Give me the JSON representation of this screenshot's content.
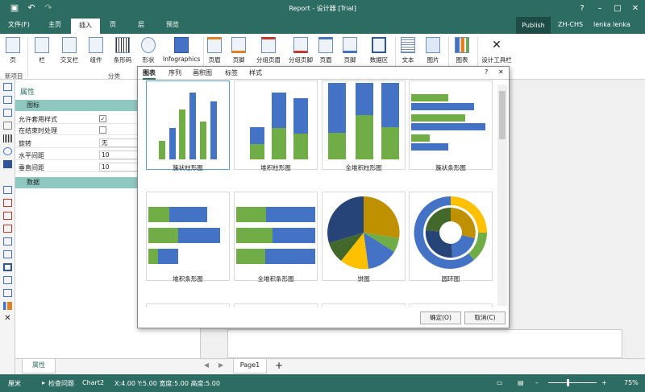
{
  "title_bar": {
    "title": "Report - 设计器 [Trial]",
    "save_icon": "save-icon",
    "undo_icon": "undo-icon",
    "redo_icon": "redo-icon",
    "window_controls": [
      "help-icon",
      "minimize-icon",
      "maximize-icon",
      "close-icon"
    ]
  },
  "menu": {
    "tabs": [
      "文件(F)",
      "主页",
      "插入",
      "页",
      "层",
      "预览"
    ],
    "active": "插入",
    "publish": "Publish",
    "language": "ZH-CHS",
    "user": "lenka lenka"
  },
  "ribbon": {
    "buttons": [
      "页",
      "栏",
      "交叉栏",
      "组件",
      "条形码",
      "形状",
      "Infographics",
      "页眉",
      "页脚",
      "分组页眉",
      "分组页脚",
      "页眉",
      "页脚",
      "数据区",
      "文本",
      "图片",
      "图表",
      "设计工具栏"
    ],
    "groups": [
      "新项目",
      "分类"
    ]
  },
  "properties": {
    "header": "属性",
    "section1": "图标",
    "rows": [
      {
        "key": "允许套用样式",
        "type": "check",
        "value": "✓"
      },
      {
        "key": "在结束时处理",
        "type": "check",
        "value": ""
      },
      {
        "key": "旋转",
        "type": "text",
        "value": "无"
      },
      {
        "key": "水平间距",
        "type": "text",
        "value": "10"
      },
      {
        "key": "垂直间距",
        "type": "text",
        "value": "10"
      }
    ],
    "section2": "数据"
  },
  "dialog": {
    "tabs": [
      "图表",
      "序列",
      "画积图",
      "标签",
      "样式"
    ],
    "active_tab": "图表",
    "help": "?",
    "tiles": [
      "簇状柱形图",
      "堆积柱形图",
      "全堆积柱形图",
      "簇状条形图",
      "堆积条形图",
      "全堆积条形图",
      "饼图",
      "圆环图"
    ],
    "ok": "确定(O)",
    "cancel": "取消(C)"
  },
  "bottom": {
    "tab": "属性",
    "page_tab": "Page1",
    "add": "+"
  },
  "status": {
    "unit": "厘米",
    "check": "检查问题",
    "component": "Chart2",
    "geometry": "X:4.00 Y:5.00 宽度:5.00 高度:5.00",
    "zoom": "75%"
  },
  "colors": {
    "teal": "#2d6c62",
    "blue": "#4472c4",
    "green": "#70ad47",
    "gold": "#bf9000",
    "yellow": "#ffc000",
    "navy": "#264478",
    "olive": "#43682b"
  }
}
